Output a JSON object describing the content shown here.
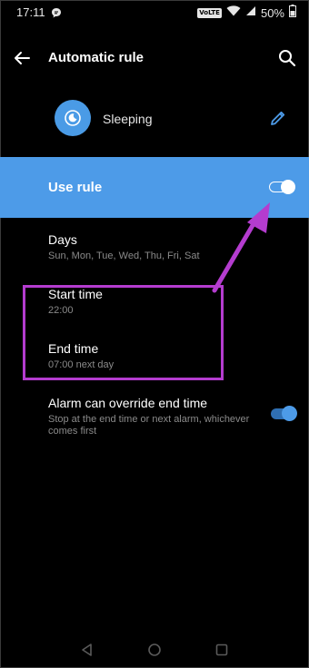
{
  "status_bar": {
    "time": "17:11",
    "volte": "VoLTE",
    "battery_percent": "50%"
  },
  "app_bar": {
    "title": "Automatic rule",
    "icons": [
      "back-arrow-icon",
      "search-icon"
    ]
  },
  "rule": {
    "name": "Sleeping",
    "icon": "moon-icon",
    "edit_icon": "pencil-icon"
  },
  "use_rule": {
    "label": "Use rule",
    "enabled": true
  },
  "settings": {
    "days": {
      "title": "Days",
      "value": "Sun, Mon, Tue, Wed, Thu, Fri, Sat"
    },
    "start_time": {
      "title": "Start time",
      "value": "22:00"
    },
    "end_time": {
      "title": "End time",
      "value": "07:00 next day"
    },
    "alarm_override": {
      "title": "Alarm can override end time",
      "description": "Stop at the end time or next alarm, whichever comes first",
      "enabled": true
    }
  },
  "colors": {
    "accent": "#4d9be8",
    "annotation": "#b43ccf",
    "background": "#000000"
  },
  "nav_bar": {
    "icons": [
      "nav-back-icon",
      "nav-home-icon",
      "nav-recent-icon"
    ]
  }
}
